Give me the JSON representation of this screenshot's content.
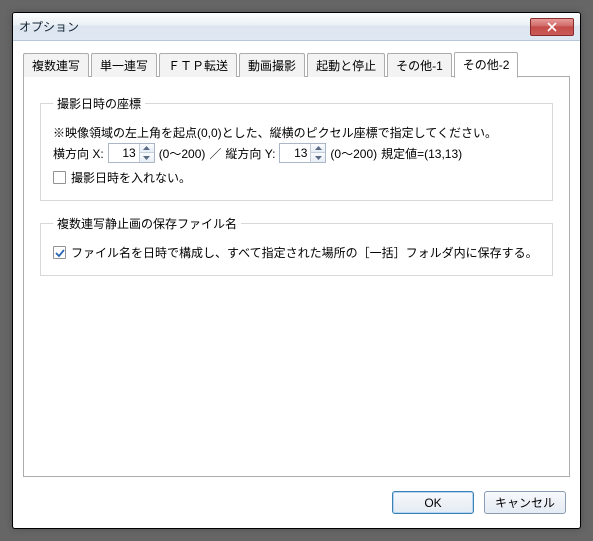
{
  "window": {
    "title": "オプション"
  },
  "tabs": {
    "items": [
      {
        "label": "複数連写"
      },
      {
        "label": "単一連写"
      },
      {
        "label": "ＦＴＰ転送"
      },
      {
        "label": "動画撮影"
      },
      {
        "label": "起動と停止"
      },
      {
        "label": "その他-1"
      },
      {
        "label": "その他-2"
      }
    ],
    "active_index": 6
  },
  "group1": {
    "legend": "撮影日時の座標",
    "note": "※映像領域の左上角を起点(0,0)とした、縦横のピクセル座標で指定してください。",
    "x_label": "横方向 X:",
    "x_value": "13",
    "x_range": "(0～200)",
    "sep": "／",
    "y_label": "縦方向 Y:",
    "y_value": "13",
    "y_range": "(0～200)",
    "default_text": "規定値=(13,13)",
    "checkbox_label": "撮影日時を入れない。",
    "checkbox_checked": false
  },
  "group2": {
    "legend": "複数連写静止画の保存ファイル名",
    "checkbox_label": "ファイル名を日時で構成し、すべて指定された場所の［一括］フォルダ内に保存する。",
    "checkbox_checked": true
  },
  "buttons": {
    "ok": "OK",
    "cancel": "キャンセル"
  }
}
